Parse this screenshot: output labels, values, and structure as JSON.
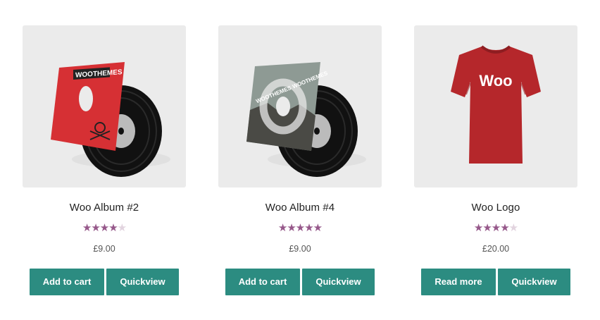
{
  "products": [
    {
      "title": "Woo Album #2",
      "rating": 4,
      "stars": [
        "★",
        "★",
        "★",
        "★",
        "★"
      ],
      "price": "£9.00",
      "primary_button": "Add to cart",
      "secondary_button": "Quickview",
      "cover_text": "WOOTHEMES"
    },
    {
      "title": "Woo Album #4",
      "rating": 5,
      "stars": [
        "★",
        "★",
        "★",
        "★",
        "★"
      ],
      "price": "£9.00",
      "primary_button": "Add to cart",
      "secondary_button": "Quickview",
      "cover_text": "WOOTHEMES WOOTHEMES"
    },
    {
      "title": "Woo Logo",
      "rating": 4,
      "stars": [
        "★",
        "★",
        "★",
        "★",
        "★"
      ],
      "price": "£20.00",
      "primary_button": "Read more",
      "secondary_button": "Quickview",
      "shirt_text": "Woo"
    }
  ],
  "colors": {
    "button": "#2c8c81",
    "star_on": "#96588a",
    "star_off": "#e2d4df",
    "thumb_bg": "#ebebeb"
  }
}
